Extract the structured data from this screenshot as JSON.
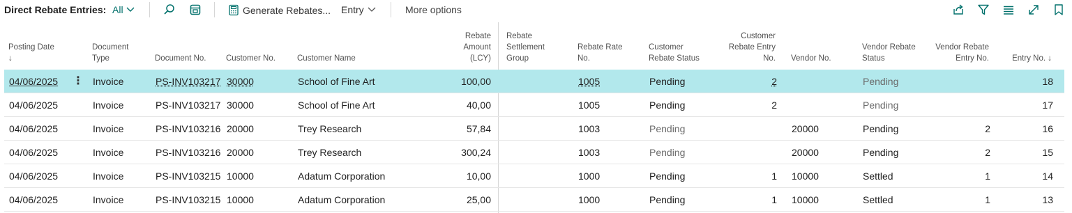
{
  "toolbar": {
    "title": "Direct Rebate Entries:",
    "view": "All",
    "generate_label": "Generate Rebates...",
    "entry_label": "Entry",
    "more_label": "More options"
  },
  "columns": {
    "posting_date": "Posting Date",
    "posting_date_sort": "↓",
    "document_type_1": "Document",
    "document_type_2": "Type",
    "document_no": "Document No.",
    "customer_no": "Customer No.",
    "customer_name": "Customer Name",
    "rebate_amount_1": "Rebate",
    "rebate_amount_2": "Amount",
    "rebate_amount_3": "(LCY)",
    "settlement_group_1": "Rebate",
    "settlement_group_2": "Settlement",
    "settlement_group_3": "Group",
    "rebate_rate_1": "Rebate Rate",
    "rebate_rate_2": "No.",
    "cust_status_1": "Customer",
    "cust_status_2": "Rebate Status",
    "cust_entry_1": "Customer",
    "cust_entry_2": "Rebate Entry",
    "cust_entry_3": "No.",
    "vendor_no": "Vendor No.",
    "vendor_status_1": "Vendor Rebate",
    "vendor_status_2": "Status",
    "vendor_entry_1": "Vendor Rebate",
    "vendor_entry_2": "Entry No.",
    "entry_no": "Entry No. ↓"
  },
  "rows": [
    {
      "posting_date": "04/06/2025",
      "document_type": "Invoice",
      "document_no": "PS-INV103217",
      "customer_no": "30000",
      "customer_name": "School of Fine Art",
      "rebate_amount": "100,00",
      "rebate_rate_no": "1005",
      "cust_status": "Pending",
      "cust_entry_no": "2",
      "vendor_no": "",
      "vendor_status": "Pending",
      "vendor_entry_no": "",
      "entry_no": "18"
    },
    {
      "posting_date": "04/06/2025",
      "document_type": "Invoice",
      "document_no": "PS-INV103217",
      "customer_no": "30000",
      "customer_name": "School of Fine Art",
      "rebate_amount": "40,00",
      "rebate_rate_no": "1005",
      "cust_status": "Pending",
      "cust_entry_no": "2",
      "vendor_no": "",
      "vendor_status": "Pending",
      "vendor_entry_no": "",
      "entry_no": "17"
    },
    {
      "posting_date": "04/06/2025",
      "document_type": "Invoice",
      "document_no": "PS-INV103216",
      "customer_no": "20000",
      "customer_name": "Trey Research",
      "rebate_amount": "57,84",
      "rebate_rate_no": "1003",
      "cust_status": "Pending",
      "cust_entry_no": "",
      "vendor_no": "20000",
      "vendor_status": "Pending",
      "vendor_entry_no": "2",
      "entry_no": "16"
    },
    {
      "posting_date": "04/06/2025",
      "document_type": "Invoice",
      "document_no": "PS-INV103216",
      "customer_no": "20000",
      "customer_name": "Trey Research",
      "rebate_amount": "300,24",
      "rebate_rate_no": "1003",
      "cust_status": "Pending",
      "cust_entry_no": "",
      "vendor_no": "20000",
      "vendor_status": "Pending",
      "vendor_entry_no": "2",
      "entry_no": "15"
    },
    {
      "posting_date": "04/06/2025",
      "document_type": "Invoice",
      "document_no": "PS-INV103215",
      "customer_no": "10000",
      "customer_name": "Adatum Corporation",
      "rebate_amount": "10,00",
      "rebate_rate_no": "1000",
      "cust_status": "Pending",
      "cust_entry_no": "1",
      "vendor_no": "10000",
      "vendor_status": "Settled",
      "vendor_entry_no": "1",
      "entry_no": "14"
    },
    {
      "posting_date": "04/06/2025",
      "document_type": "Invoice",
      "document_no": "PS-INV103215",
      "customer_no": "10000",
      "customer_name": "Adatum Corporation",
      "rebate_amount": "25,00",
      "rebate_rate_no": "1000",
      "cust_status": "Pending",
      "cust_entry_no": "1",
      "vendor_no": "10000",
      "vendor_status": "Settled",
      "vendor_entry_no": "1",
      "entry_no": "13"
    }
  ],
  "row_menu_glyph": "⋮",
  "colors": {
    "accent": "#00706b",
    "selected_row": "#b2e8ec"
  }
}
